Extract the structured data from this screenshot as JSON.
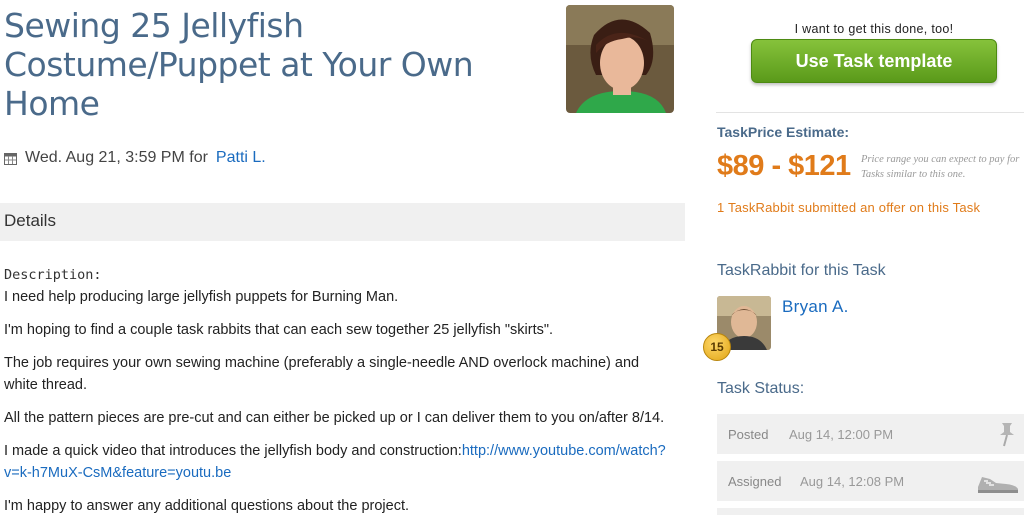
{
  "task": {
    "title": "Sewing 25 Jellyfish Costume/Puppet at Your Own Home",
    "date": "Wed. Aug 21, 3:59 PM for",
    "owner_name": "Patti L."
  },
  "details": {
    "heading": "Details",
    "description_label": "Description:",
    "paragraphs": [
      "I need help producing large jellyfish puppets for Burning Man.",
      "I'm hoping to find a couple task rabbits that can each sew together 25 jellyfish \"skirts\".",
      "The job requires your own sewing machine (preferably a single-needle AND overlock machine) and white thread.",
      "All the pattern pieces are pre-cut and can either be picked up or I can deliver them to you on/after 8/14."
    ],
    "video_intro": "I made a quick video that introduces the jellyfish body and construction:",
    "video_link": "http://www.youtube.com/watch?v=k-h7MuX-CsM&feature=youtu.be",
    "closing": "I'm happy to answer any additional questions about the project."
  },
  "sidebar": {
    "want_text": "I want to get this done, too!",
    "template_button": "Use Task template",
    "estimate_label": "TaskPrice Estimate:",
    "estimate_range": "$89 - $121",
    "estimate_note": "Price range you can expect to pay for Tasks similar to this one.",
    "offer_text": "1 TaskRabbit submitted an offer on this Task",
    "taskrabbit_label": "TaskRabbit for this Task",
    "taskrabbit_name": "Bryan A.",
    "taskrabbit_level": "15",
    "status_label": "Task Status:",
    "status": [
      {
        "name": "Posted",
        "when": "Aug 14, 12:00 PM",
        "icon": "pushpin-icon"
      },
      {
        "name": "Assigned",
        "when": "Aug 14, 12:08 PM",
        "icon": "sneakers-icon"
      }
    ]
  },
  "colors": {
    "title": "#4a6a8a",
    "link": "#1a6bbf",
    "accent_orange": "#e07b1a",
    "button_green": "#6aa82a"
  }
}
